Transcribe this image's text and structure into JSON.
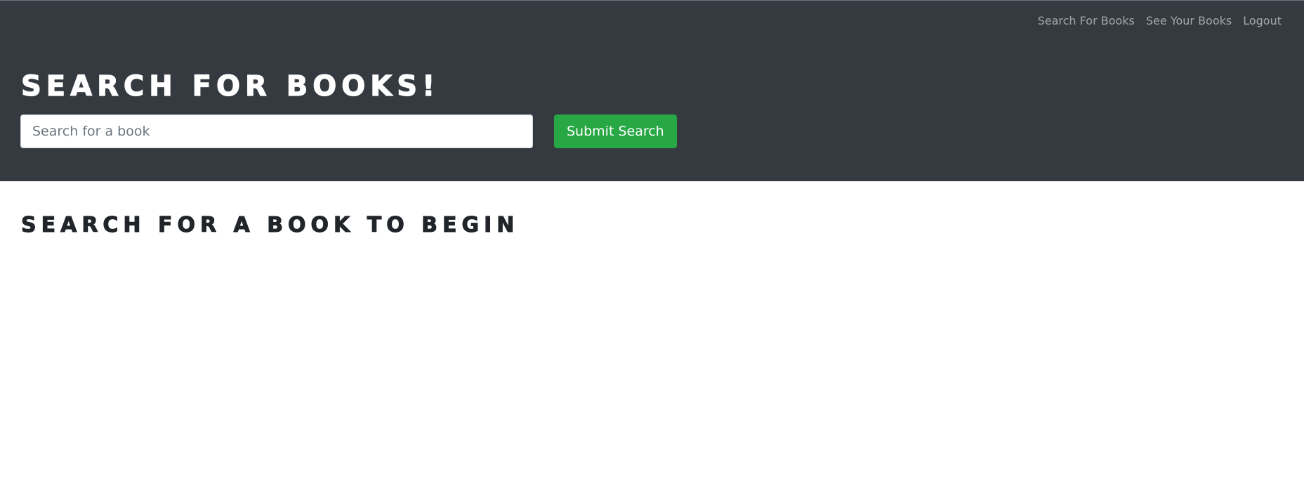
{
  "nav": {
    "items": [
      {
        "label": "Search For Books"
      },
      {
        "label": "See Your Books"
      },
      {
        "label": "Logout"
      }
    ]
  },
  "header": {
    "title": "Search for Books!",
    "search_placeholder": "Search for a book",
    "search_value": "",
    "submit_label": "Submit Search"
  },
  "main": {
    "heading": "Search for a book to begin"
  },
  "colors": {
    "header_bg": "#343a40",
    "accent_green": "#28a745",
    "nav_text": "rgba(255,255,255,0.55)",
    "heading_text": "#212529"
  }
}
